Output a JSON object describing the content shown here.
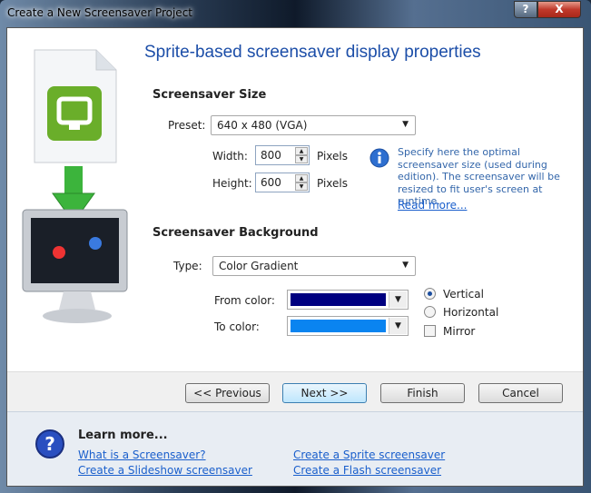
{
  "window": {
    "title": "Create a New Screensaver Project",
    "help_label": "?",
    "close_label": "X"
  },
  "heading": "Sprite-based screensaver display properties",
  "size": {
    "section": "Screensaver Size",
    "preset_label": "Preset:",
    "preset_value": "640 x 480 (VGA)",
    "width_label": "Width:",
    "width_value": "800",
    "height_label": "Height:",
    "height_value": "600",
    "unit": "Pixels",
    "info": "Specify here the optimal screensaver size (used during edition). The screensaver will be resized to fit user's screen at runtime.",
    "read_more": "Read more..."
  },
  "background": {
    "section": "Screensaver Background",
    "type_label": "Type:",
    "type_value": "Color Gradient",
    "from_label": "From color:",
    "from_color": "#000080",
    "to_label": "To color:",
    "to_color": "#0a84f0",
    "vertical": "Vertical",
    "horizontal": "Horizontal",
    "mirror": "Mirror",
    "selected": "Vertical",
    "mirror_checked": false
  },
  "buttons": {
    "previous": "<< Previous",
    "next": "Next >>",
    "finish": "Finish",
    "cancel": "Cancel"
  },
  "learn": {
    "title": "Learn more...",
    "links": [
      "What is a Screensaver?",
      "Create a Sprite screensaver",
      "Create a Slideshow screensaver",
      "Create a Flash screensaver"
    ]
  }
}
